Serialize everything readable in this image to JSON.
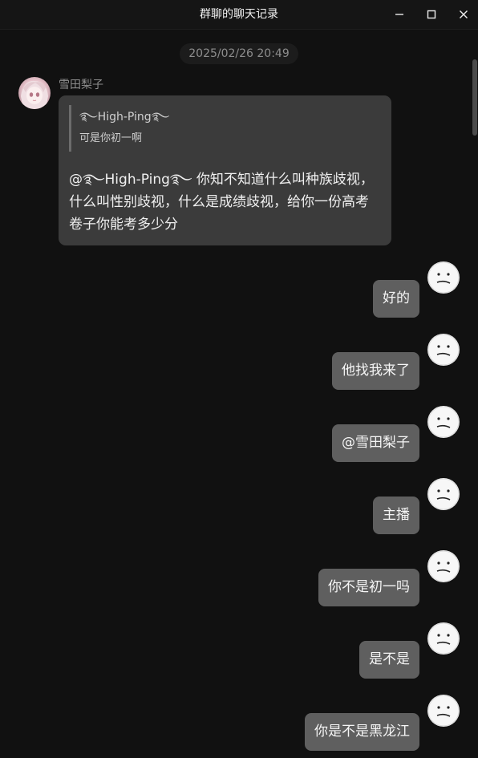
{
  "window": {
    "title": "群聊的聊天记录",
    "controls": [
      "minimize-icon",
      "maximize-icon",
      "close-icon"
    ]
  },
  "chat": {
    "timestamp": "2025/02/26 20:49",
    "first_message": {
      "sender": "雪田梨子",
      "avatar": "anime-avatar",
      "quote": {
        "author": "࿐High-Ping࿐",
        "text": "可是你初一啊"
      },
      "text": "@࿐High-Ping࿐ 你知不知道什么叫种族歧视，什么叫性别歧视，什么是成绩歧视，给你一份高考卷子你能考多少分"
    },
    "replies": [
      {
        "text": "好的",
        "avatar": "neutral-face-icon"
      },
      {
        "text": "他找我来了",
        "avatar": "neutral-face-icon"
      },
      {
        "text": "@雪田梨子",
        "avatar": "neutral-face-icon"
      },
      {
        "text": "主播",
        "avatar": "neutral-face-icon"
      },
      {
        "text": "你不是初一吗",
        "avatar": "neutral-face-icon"
      },
      {
        "text": "是不是",
        "avatar": "neutral-face-icon"
      },
      {
        "text": "你是不是黑龙江",
        "avatar": "neutral-face-icon"
      }
    ]
  },
  "colors": {
    "background": "#111111",
    "incoming_bubble": "#3b3b3b",
    "outgoing_bubble": "#5f5f5f",
    "muted_text": "#8f8f8f"
  }
}
